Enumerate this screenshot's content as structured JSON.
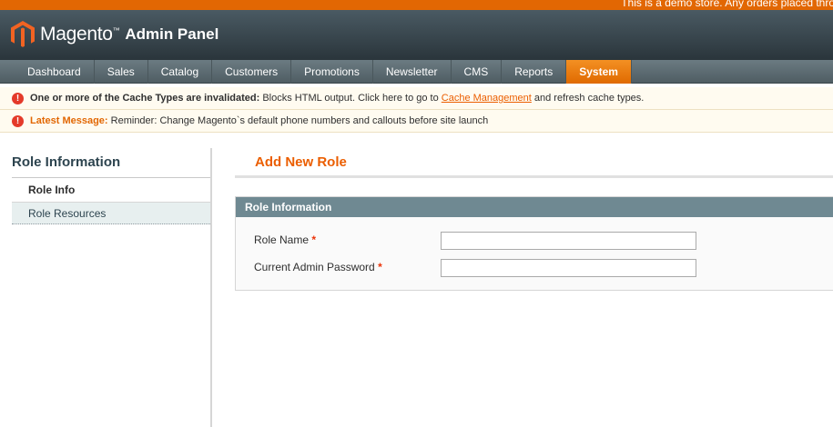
{
  "demo_notice": "This is a demo store. Any orders placed thro",
  "header": {
    "logo_text": "Magento",
    "logo_tm": "™",
    "logo_sub": "Admin Panel"
  },
  "nav": [
    {
      "label": "Dashboard"
    },
    {
      "label": "Sales"
    },
    {
      "label": "Catalog"
    },
    {
      "label": "Customers"
    },
    {
      "label": "Promotions"
    },
    {
      "label": "Newsletter"
    },
    {
      "label": "CMS"
    },
    {
      "label": "Reports"
    },
    {
      "label": "System",
      "active": true
    }
  ],
  "messages": {
    "cache": {
      "bold": "One or more of the Cache Types are invalidated:",
      "text": " Blocks HTML output. Click here to go to ",
      "link": "Cache Management",
      "after": " and refresh cache types."
    },
    "latest": {
      "bold": "Latest Message:",
      "text": " Reminder: Change Magento`s default phone numbers and callouts before site launch"
    }
  },
  "sidebar": {
    "title": "Role Information",
    "items": [
      {
        "label": "Role Info",
        "active": true
      },
      {
        "label": "Role Resources",
        "active": false
      }
    ]
  },
  "main": {
    "title": "Add New Role",
    "fieldset_title": "Role Information",
    "fields": [
      {
        "label": "Role Name",
        "required": "*",
        "value": ""
      },
      {
        "label": "Current Admin Password",
        "required": "*",
        "value": ""
      }
    ]
  },
  "colors": {
    "accent": "#eb5e00",
    "brand": "#e26703",
    "header": "#2a353b",
    "fieldset_head": "#6f8992"
  }
}
